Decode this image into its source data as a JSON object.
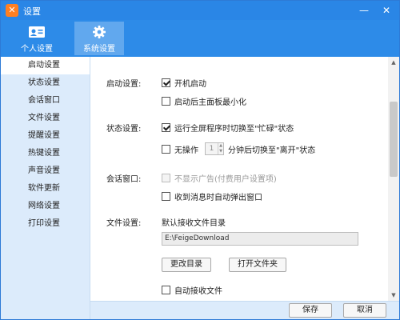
{
  "window": {
    "title": "设置",
    "app_icon": "feige-logo",
    "min_symbol": "—",
    "close_symbol": "✕"
  },
  "tabs": [
    {
      "label": "个人设置",
      "icon": "id-card-icon"
    },
    {
      "label": "系统设置",
      "icon": "gear-icon",
      "selected": true
    }
  ],
  "sidebar": {
    "items": [
      {
        "label": "启动设置",
        "active": true
      },
      {
        "label": "状态设置"
      },
      {
        "label": "会话窗口"
      },
      {
        "label": "文件设置"
      },
      {
        "label": "提醒设置"
      },
      {
        "label": "热键设置"
      },
      {
        "label": "声音设置"
      },
      {
        "label": "软件更新"
      },
      {
        "label": "网络设置"
      },
      {
        "label": "打印设置"
      }
    ]
  },
  "startup": {
    "section": "启动设置:",
    "boot_start": {
      "label": "开机启动",
      "checked": true
    },
    "minimize": {
      "label": "启动后主面板最小化",
      "checked": false
    }
  },
  "status": {
    "section": "状态设置:",
    "fullscreen_busy": {
      "label": "运行全屏程序时切换至\"忙碌\"状态",
      "checked": true
    },
    "idle": {
      "label": "无操作",
      "checked": false,
      "minutes": "1",
      "suffix": "分钟后切换至\"离开\"状态"
    }
  },
  "session": {
    "section": "会话窗口:",
    "no_ads": {
      "label": "不显示广告(付费用户设置项)",
      "checked": false,
      "disabled": true
    },
    "popup": {
      "label": "收到消息时自动弹出窗口",
      "checked": false
    }
  },
  "files": {
    "section": "文件设置:",
    "default_dir_label": "默认接收文件目录",
    "path": "E:\\FeigeDownload",
    "change_dir": "更改目录",
    "open_folder": "打开文件夹",
    "auto_receive": {
      "label": "自动接收文件",
      "checked": false
    }
  },
  "scrollbar": {
    "up": "▲",
    "down": "▼"
  },
  "footer": {
    "save": "保存",
    "cancel": "取消"
  },
  "colors": {
    "title_bar": "#2a86e6",
    "tab_bar": "#2d8be8",
    "sidebar_bg": "#dcebfb",
    "app_icon": "#ff7f22"
  }
}
